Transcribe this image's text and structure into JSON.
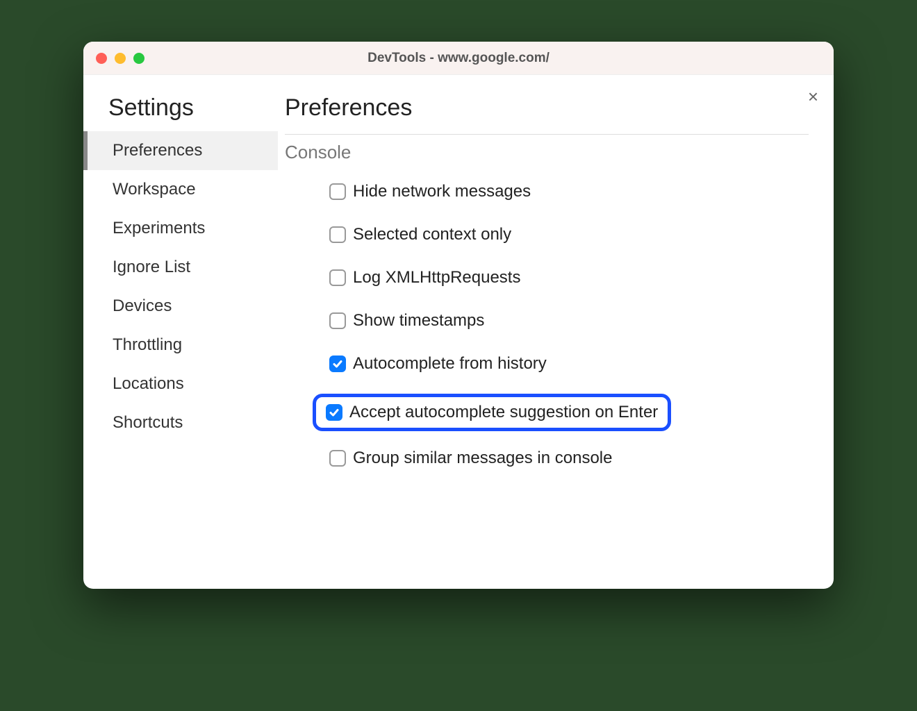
{
  "window": {
    "title": "DevTools - www.google.com/"
  },
  "sidebar": {
    "title": "Settings",
    "items": [
      {
        "label": "Preferences",
        "active": true
      },
      {
        "label": "Workspace",
        "active": false
      },
      {
        "label": "Experiments",
        "active": false
      },
      {
        "label": "Ignore List",
        "active": false
      },
      {
        "label": "Devices",
        "active": false
      },
      {
        "label": "Throttling",
        "active": false
      },
      {
        "label": "Locations",
        "active": false
      },
      {
        "label": "Shortcuts",
        "active": false
      }
    ]
  },
  "main": {
    "title": "Preferences",
    "section": "Console",
    "options": [
      {
        "label": "Hide network messages",
        "checked": false,
        "highlighted": false
      },
      {
        "label": "Selected context only",
        "checked": false,
        "highlighted": false
      },
      {
        "label": "Log XMLHttpRequests",
        "checked": false,
        "highlighted": false
      },
      {
        "label": "Show timestamps",
        "checked": false,
        "highlighted": false
      },
      {
        "label": "Autocomplete from history",
        "checked": true,
        "highlighted": false
      },
      {
        "label": "Accept autocomplete suggestion on Enter",
        "checked": true,
        "highlighted": true
      },
      {
        "label": "Group similar messages in console",
        "checked": false,
        "highlighted": false
      }
    ]
  }
}
